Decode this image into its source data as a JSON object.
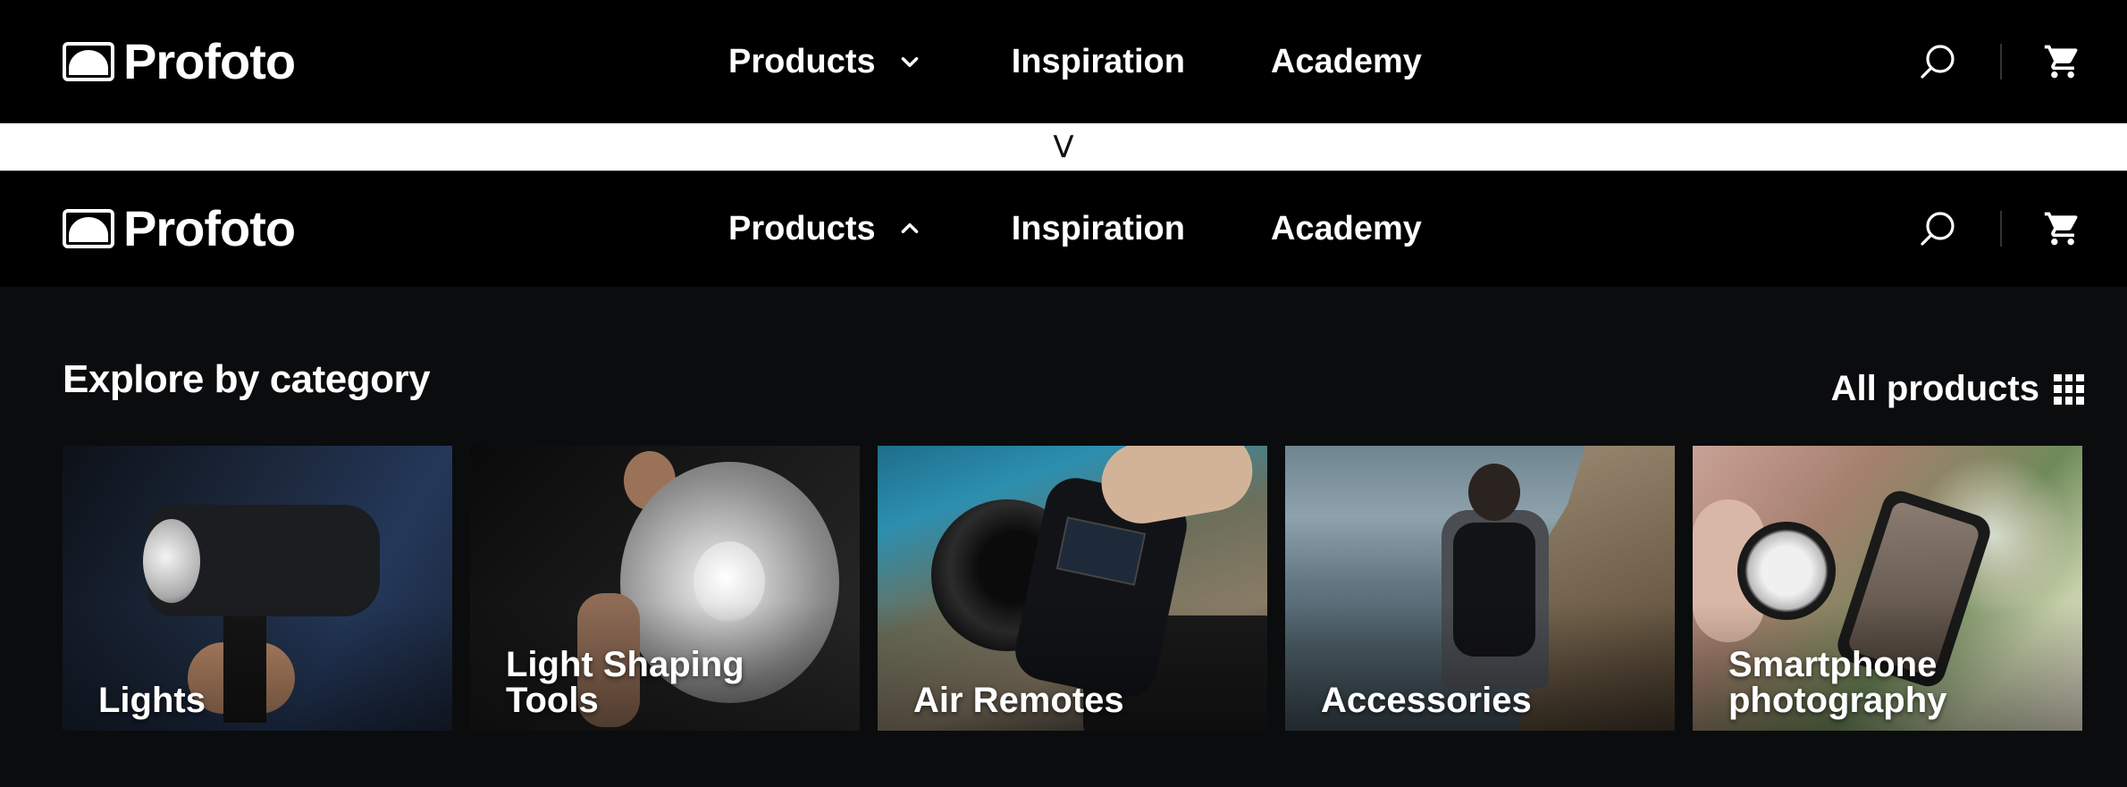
{
  "brand": {
    "name": "Profoto"
  },
  "nav": {
    "items": [
      {
        "label": "Products"
      },
      {
        "label": "Inspiration"
      },
      {
        "label": "Academy"
      }
    ]
  },
  "separator": {
    "text": "V"
  },
  "dropdown": {
    "title": "Explore by category",
    "all_products_label": "All products",
    "categories": [
      {
        "label": "Lights"
      },
      {
        "label": "Light Shaping Tools"
      },
      {
        "label": "Air Remotes"
      },
      {
        "label": "Accessories"
      },
      {
        "label": "Smartphone photography"
      }
    ]
  },
  "icons": {
    "search": "search-icon",
    "cart": "cart-icon",
    "chevron_down": "chevron-down-icon",
    "chevron_up": "chevron-up-icon",
    "grid": "grid-icon"
  },
  "colors": {
    "nav_background": "#000000",
    "dropdown_background": "#0b0c0e",
    "text": "#ffffff"
  }
}
